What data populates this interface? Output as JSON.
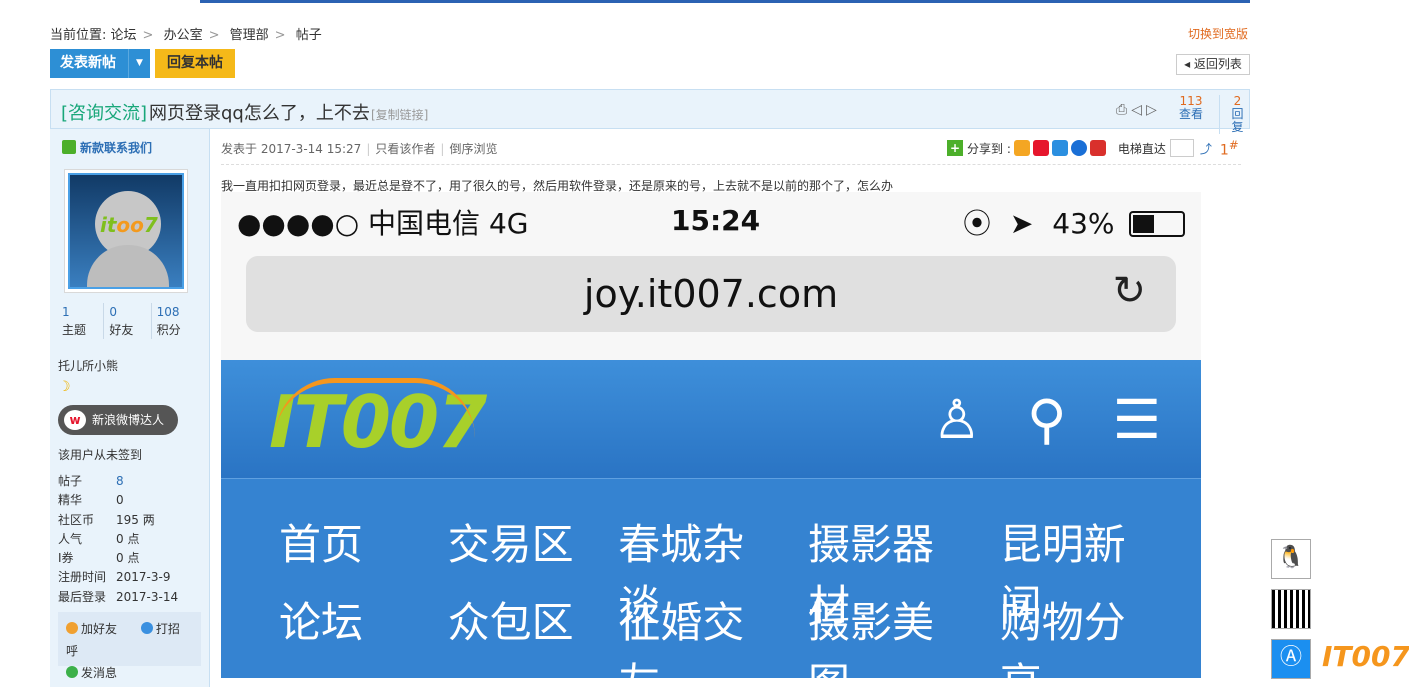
{
  "breadcrumb": {
    "prefix": "当前位置:",
    "items": [
      "论坛",
      "办公室",
      "管理部",
      "帖子"
    ]
  },
  "wide_link": "切换到宽版",
  "toolbar": {
    "new_post": "发表新帖",
    "reply": "回复本帖",
    "back": "返回列表"
  },
  "thread": {
    "category": "[咨询交流]",
    "title": "网页登录qq怎么了，上不去",
    "copy_link": "[复制链接]",
    "views": {
      "num": "113",
      "label": "查看"
    },
    "replies": {
      "num": "2",
      "label": "回复"
    }
  },
  "author": {
    "contact_link": "新款联系我们",
    "stats": [
      {
        "n": "1",
        "l": "主题"
      },
      {
        "n": "0",
        "l": "好友"
      },
      {
        "n": "108",
        "l": "积分"
      }
    ],
    "nickname": "托儿所小熊",
    "badge": "新浪微博达人",
    "sign_status": "该用户从未签到",
    "profile": [
      {
        "k": "帖子",
        "v": "8"
      },
      {
        "k": "精华",
        "v": "0"
      },
      {
        "k": "社区币",
        "v": "195 两"
      },
      {
        "k": "人气",
        "v": "0 点"
      },
      {
        "k": "I券",
        "v": "0 点"
      },
      {
        "k": "注册时间",
        "v": "2017-3-9"
      },
      {
        "k": "最后登录",
        "v": "2017-3-14"
      }
    ],
    "actions": {
      "add_friend": "加好友",
      "greet": "打招呼",
      "message": "发消息"
    }
  },
  "post": {
    "posted_at": "发表于 2017-3-14 15:27",
    "only_author": "只看该作者",
    "reverse": "倒序浏览",
    "share_label": "分享到 :",
    "elevator": "电梯直达",
    "floor": "1",
    "text": "我一直用扣扣网页登录，最近总是登不了，用了很久的号，然后用软件登录，还是原来的号，上去就不是以前的那个了，怎么办"
  },
  "phone": {
    "signal": "●●●●○ 中国电信   4G",
    "time": "15:24",
    "battery": "43%",
    "battery_level": 0.43,
    "url": "joy.it007.com",
    "logo": "IT007",
    "nav_row1": [
      "首页",
      "交易区",
      "春城杂谈",
      "摄影器材",
      "昆明新闻"
    ],
    "nav_row2": [
      "论坛",
      "众包区",
      "征婚交友",
      "摄影美图",
      "购物分享"
    ]
  },
  "corner_logo": "IT007"
}
